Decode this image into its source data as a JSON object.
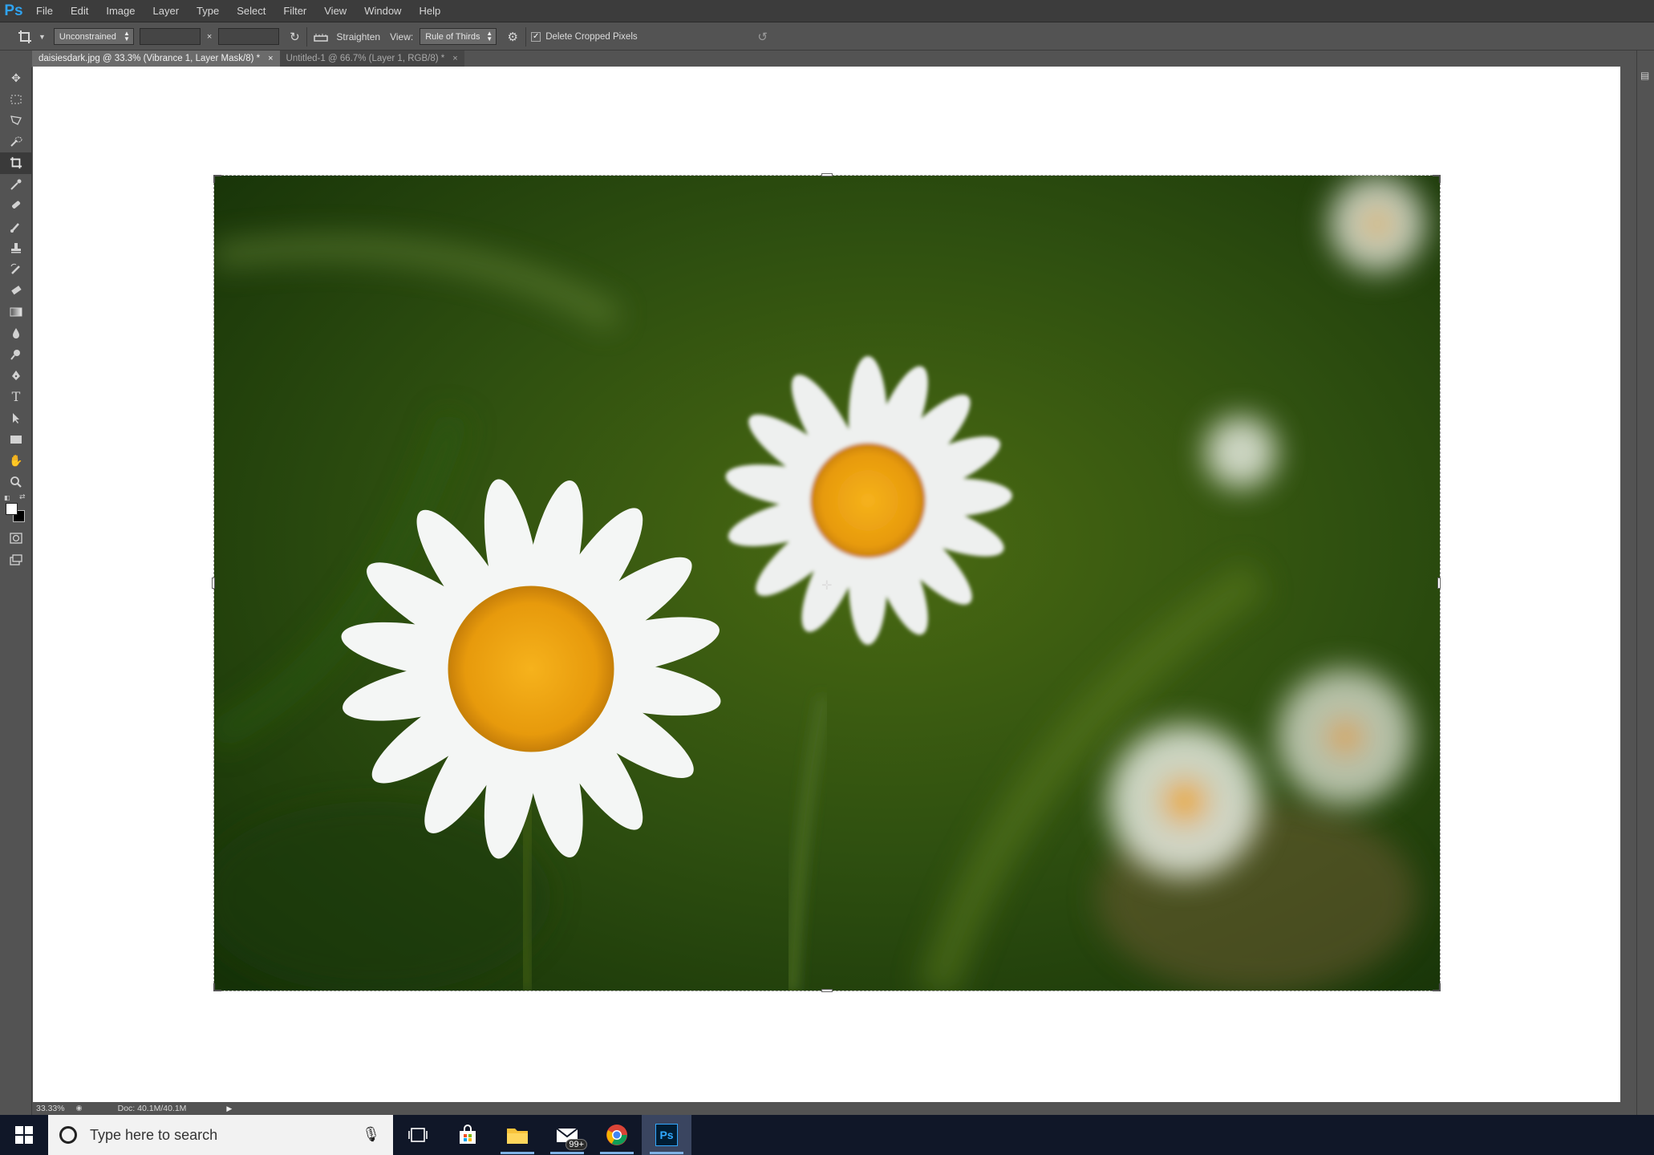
{
  "app": {
    "logo_text": "Ps"
  },
  "menu": [
    "File",
    "Edit",
    "Image",
    "Layer",
    "Type",
    "Select",
    "Filter",
    "View",
    "Window",
    "Help"
  ],
  "options": {
    "ratio_label": "Unconstrained",
    "width_value": "",
    "times": "×",
    "height_value": "",
    "straighten_label": "Straighten",
    "view_label": "View:",
    "view_value": "Rule of Thirds",
    "delete_cropped_label": "Delete Cropped Pixels",
    "delete_cropped_checked": "✓"
  },
  "tabs": [
    {
      "label": "daisiesdark.jpg @ 33.3% (Vibrance 1, Layer Mask/8) *",
      "close": "×"
    },
    {
      "label": "Untitled-1 @ 66.7% (Layer 1, RGB/8) *",
      "close": "×"
    }
  ],
  "status": {
    "zoom": "33.33%",
    "doc": "Doc: 40.1M/40.1M"
  },
  "taskbar": {
    "search_placeholder": "Type here to search",
    "mail_badge": "99+"
  },
  "colors": {
    "foreground": "#ffffff",
    "background": "#000000"
  }
}
